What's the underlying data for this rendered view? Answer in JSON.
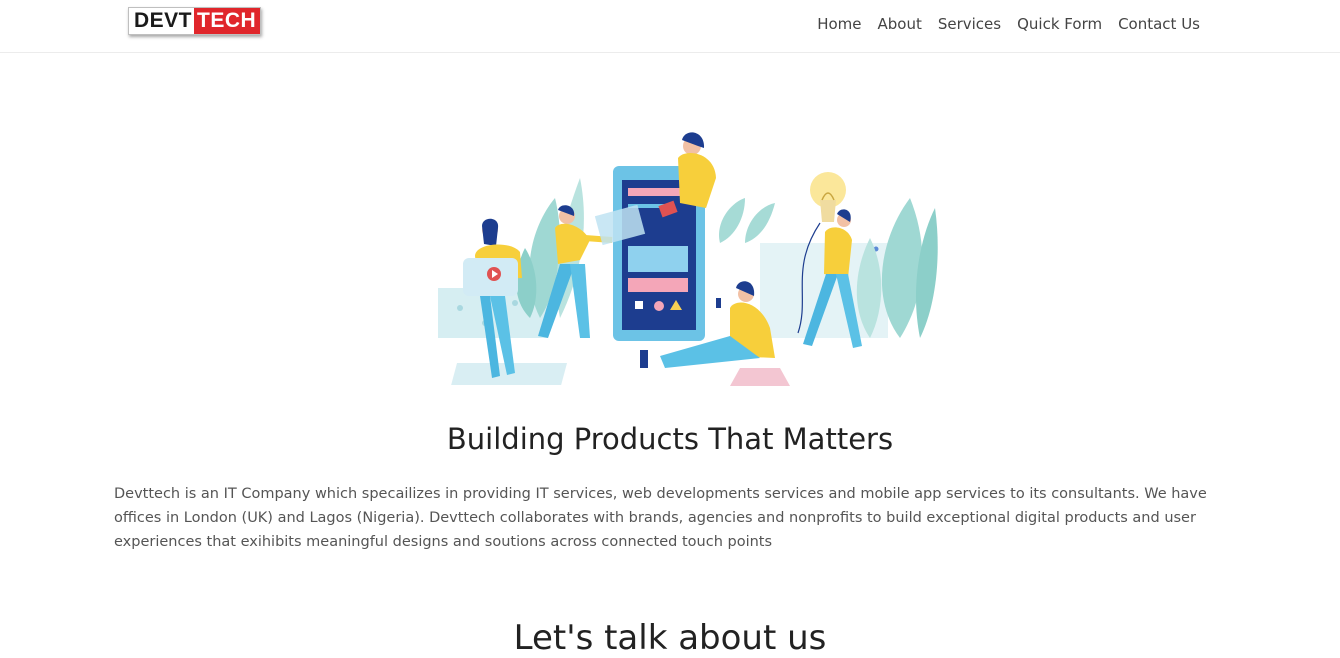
{
  "brand": {
    "logo_part1": "DEVT",
    "logo_part2": "TECH",
    "colors": {
      "accent": "#e0262b",
      "dark": "#1a1a1a"
    }
  },
  "nav": {
    "items": [
      {
        "label": "Home"
      },
      {
        "label": "About"
      },
      {
        "label": "Services"
      },
      {
        "label": "Quick Form"
      },
      {
        "label": "Contact Us"
      }
    ]
  },
  "hero": {
    "illustration": "team-building-app-illustration"
  },
  "about": {
    "title": "Building Products That Matters",
    "body": "Devttech is an IT Company which specailizes in providing IT services, web developments services and mobile app services to its consultants. We have offices in London (UK) and Lagos (Nigeria). Devttech collaborates with brands, agencies and nonprofits to build exceptional digital products and user experiences that exihibits meaningful designs and soutions across connected touch points"
  },
  "next_section": {
    "title": "Let's talk about us"
  }
}
